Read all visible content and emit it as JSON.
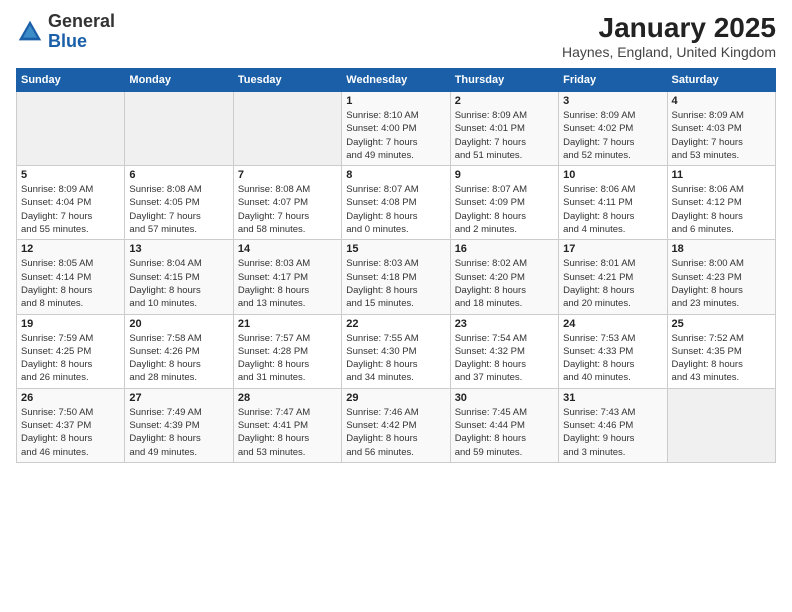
{
  "logo": {
    "general": "General",
    "blue": "Blue"
  },
  "header": {
    "title": "January 2025",
    "subtitle": "Haynes, England, United Kingdom"
  },
  "weekdays": [
    "Sunday",
    "Monday",
    "Tuesday",
    "Wednesday",
    "Thursday",
    "Friday",
    "Saturday"
  ],
  "weeks": [
    [
      {
        "day": "",
        "detail": ""
      },
      {
        "day": "",
        "detail": ""
      },
      {
        "day": "",
        "detail": ""
      },
      {
        "day": "1",
        "detail": "Sunrise: 8:10 AM\nSunset: 4:00 PM\nDaylight: 7 hours\nand 49 minutes."
      },
      {
        "day": "2",
        "detail": "Sunrise: 8:09 AM\nSunset: 4:01 PM\nDaylight: 7 hours\nand 51 minutes."
      },
      {
        "day": "3",
        "detail": "Sunrise: 8:09 AM\nSunset: 4:02 PM\nDaylight: 7 hours\nand 52 minutes."
      },
      {
        "day": "4",
        "detail": "Sunrise: 8:09 AM\nSunset: 4:03 PM\nDaylight: 7 hours\nand 53 minutes."
      }
    ],
    [
      {
        "day": "5",
        "detail": "Sunrise: 8:09 AM\nSunset: 4:04 PM\nDaylight: 7 hours\nand 55 minutes."
      },
      {
        "day": "6",
        "detail": "Sunrise: 8:08 AM\nSunset: 4:05 PM\nDaylight: 7 hours\nand 57 minutes."
      },
      {
        "day": "7",
        "detail": "Sunrise: 8:08 AM\nSunset: 4:07 PM\nDaylight: 7 hours\nand 58 minutes."
      },
      {
        "day": "8",
        "detail": "Sunrise: 8:07 AM\nSunset: 4:08 PM\nDaylight: 8 hours\nand 0 minutes."
      },
      {
        "day": "9",
        "detail": "Sunrise: 8:07 AM\nSunset: 4:09 PM\nDaylight: 8 hours\nand 2 minutes."
      },
      {
        "day": "10",
        "detail": "Sunrise: 8:06 AM\nSunset: 4:11 PM\nDaylight: 8 hours\nand 4 minutes."
      },
      {
        "day": "11",
        "detail": "Sunrise: 8:06 AM\nSunset: 4:12 PM\nDaylight: 8 hours\nand 6 minutes."
      }
    ],
    [
      {
        "day": "12",
        "detail": "Sunrise: 8:05 AM\nSunset: 4:14 PM\nDaylight: 8 hours\nand 8 minutes."
      },
      {
        "day": "13",
        "detail": "Sunrise: 8:04 AM\nSunset: 4:15 PM\nDaylight: 8 hours\nand 10 minutes."
      },
      {
        "day": "14",
        "detail": "Sunrise: 8:03 AM\nSunset: 4:17 PM\nDaylight: 8 hours\nand 13 minutes."
      },
      {
        "day": "15",
        "detail": "Sunrise: 8:03 AM\nSunset: 4:18 PM\nDaylight: 8 hours\nand 15 minutes."
      },
      {
        "day": "16",
        "detail": "Sunrise: 8:02 AM\nSunset: 4:20 PM\nDaylight: 8 hours\nand 18 minutes."
      },
      {
        "day": "17",
        "detail": "Sunrise: 8:01 AM\nSunset: 4:21 PM\nDaylight: 8 hours\nand 20 minutes."
      },
      {
        "day": "18",
        "detail": "Sunrise: 8:00 AM\nSunset: 4:23 PM\nDaylight: 8 hours\nand 23 minutes."
      }
    ],
    [
      {
        "day": "19",
        "detail": "Sunrise: 7:59 AM\nSunset: 4:25 PM\nDaylight: 8 hours\nand 26 minutes."
      },
      {
        "day": "20",
        "detail": "Sunrise: 7:58 AM\nSunset: 4:26 PM\nDaylight: 8 hours\nand 28 minutes."
      },
      {
        "day": "21",
        "detail": "Sunrise: 7:57 AM\nSunset: 4:28 PM\nDaylight: 8 hours\nand 31 minutes."
      },
      {
        "day": "22",
        "detail": "Sunrise: 7:55 AM\nSunset: 4:30 PM\nDaylight: 8 hours\nand 34 minutes."
      },
      {
        "day": "23",
        "detail": "Sunrise: 7:54 AM\nSunset: 4:32 PM\nDaylight: 8 hours\nand 37 minutes."
      },
      {
        "day": "24",
        "detail": "Sunrise: 7:53 AM\nSunset: 4:33 PM\nDaylight: 8 hours\nand 40 minutes."
      },
      {
        "day": "25",
        "detail": "Sunrise: 7:52 AM\nSunset: 4:35 PM\nDaylight: 8 hours\nand 43 minutes."
      }
    ],
    [
      {
        "day": "26",
        "detail": "Sunrise: 7:50 AM\nSunset: 4:37 PM\nDaylight: 8 hours\nand 46 minutes."
      },
      {
        "day": "27",
        "detail": "Sunrise: 7:49 AM\nSunset: 4:39 PM\nDaylight: 8 hours\nand 49 minutes."
      },
      {
        "day": "28",
        "detail": "Sunrise: 7:47 AM\nSunset: 4:41 PM\nDaylight: 8 hours\nand 53 minutes."
      },
      {
        "day": "29",
        "detail": "Sunrise: 7:46 AM\nSunset: 4:42 PM\nDaylight: 8 hours\nand 56 minutes."
      },
      {
        "day": "30",
        "detail": "Sunrise: 7:45 AM\nSunset: 4:44 PM\nDaylight: 8 hours\nand 59 minutes."
      },
      {
        "day": "31",
        "detail": "Sunrise: 7:43 AM\nSunset: 4:46 PM\nDaylight: 9 hours\nand 3 minutes."
      },
      {
        "day": "",
        "detail": ""
      }
    ]
  ]
}
